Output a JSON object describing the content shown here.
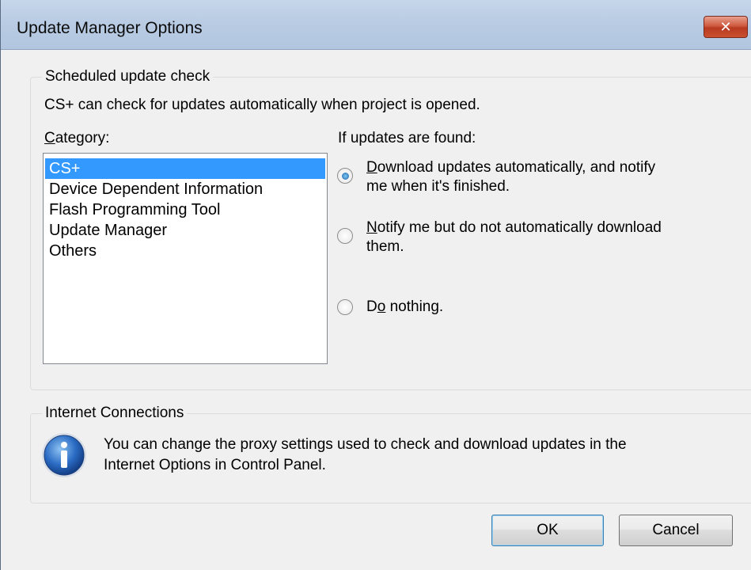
{
  "window": {
    "title": "Update Manager Options",
    "close_symbol": "✕"
  },
  "scheduled": {
    "legend": "Scheduled update check",
    "description": "CS+ can check for updates automatically when project is opened.",
    "category_label_first": "C",
    "category_label_rest": "ategory:",
    "categories": [
      "CS+",
      "Device Dependent Information",
      "Flash Programming Tool",
      "Update Manager",
      "Others"
    ],
    "selected_category": "CS+",
    "found_label": "If updates are found:",
    "options": [
      {
        "mnemonic": "D",
        "rest": "ownload updates automatically, and notify",
        "line2": "me when it's finished.",
        "checked": true
      },
      {
        "mnemonic": "N",
        "rest": "otify me but do not automatically download",
        "line2": "them.",
        "checked": false
      },
      {
        "pre": "D",
        "mnemonic": "o",
        "rest": " nothing.",
        "checked": false
      }
    ]
  },
  "internet": {
    "legend": "Internet Connections",
    "line1": "You can change the proxy settings used to check and download updates in the",
    "line2": "Internet Options in Control Panel.",
    "icon": "info-icon"
  },
  "buttons": {
    "ok": "OK",
    "cancel": "Cancel"
  }
}
